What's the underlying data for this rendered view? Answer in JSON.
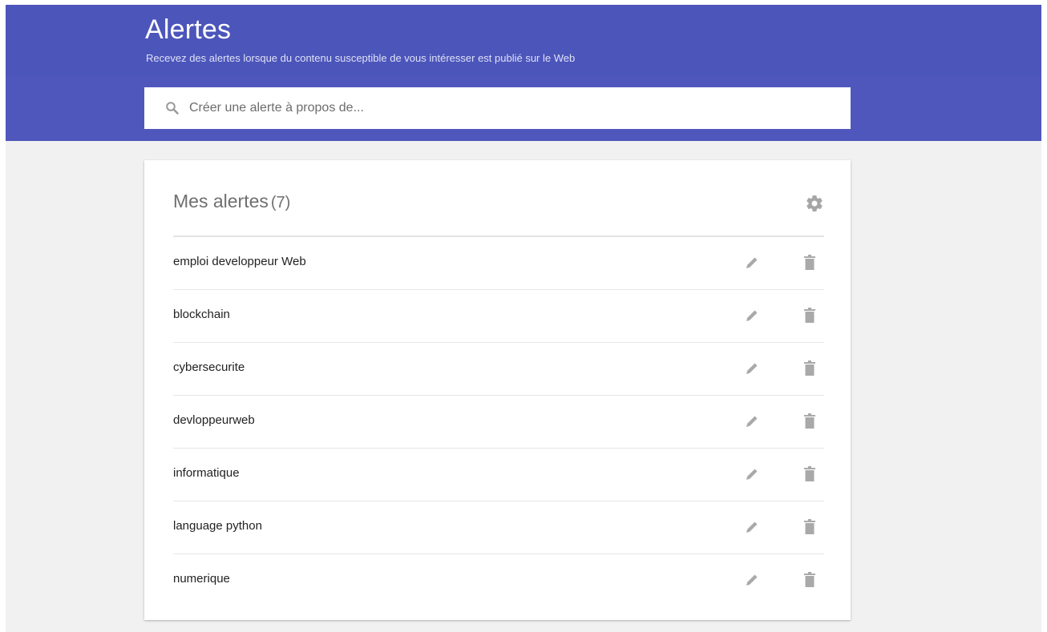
{
  "header": {
    "title": "Alertes",
    "subtitle": "Recevez des alertes lorsque du contenu susceptible de vous intéresser est publié sur le Web",
    "background_color": "#4f57bd"
  },
  "search": {
    "placeholder": "Créer une alerte à propos de...",
    "value": "",
    "icon": "search-icon"
  },
  "alerts": {
    "title": "Mes alertes",
    "count": "(7)",
    "settings_icon": "gear-icon",
    "edit_icon": "pencil-icon",
    "delete_icon": "trash-icon",
    "items": [
      {
        "label": "emploi developpeur Web"
      },
      {
        "label": "blockchain"
      },
      {
        "label": "cybersecurite"
      },
      {
        "label": "devloppeurweb"
      },
      {
        "label": "informatique"
      },
      {
        "label": "language python"
      },
      {
        "label": "numerique"
      }
    ]
  }
}
